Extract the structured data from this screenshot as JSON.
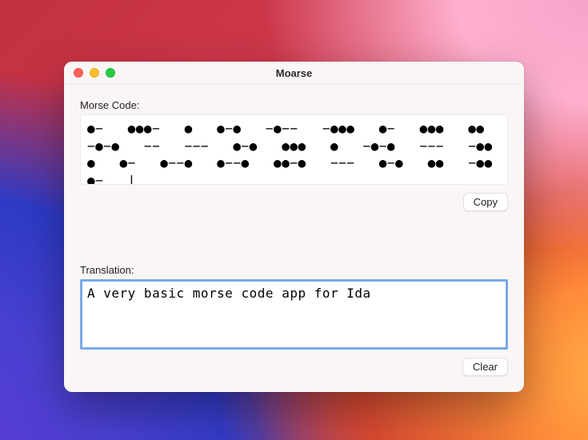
{
  "window": {
    "title": "Moarse",
    "traffic_lights": {
      "close": "close-icon",
      "minimize": "minimize-icon",
      "zoom": "zoom-icon"
    }
  },
  "morse": {
    "label": "Morse Code:",
    "value": "●−   ●●●−   ●   ●−●   −●−−   −●●●   ●−   ●●●   ●●   −●−●   −−   −−−   ●−●   ●●●   ●   −●−●   −−−   −●●   ●   ●−   ●−−●   ●−−●   ●●−●   −−−   ●−●   ●●   −●●   ●−   |",
    "copy_label": "Copy"
  },
  "translation": {
    "label": "Translation:",
    "value": "A very basic morse code app for Ida",
    "clear_label": "Clear"
  }
}
